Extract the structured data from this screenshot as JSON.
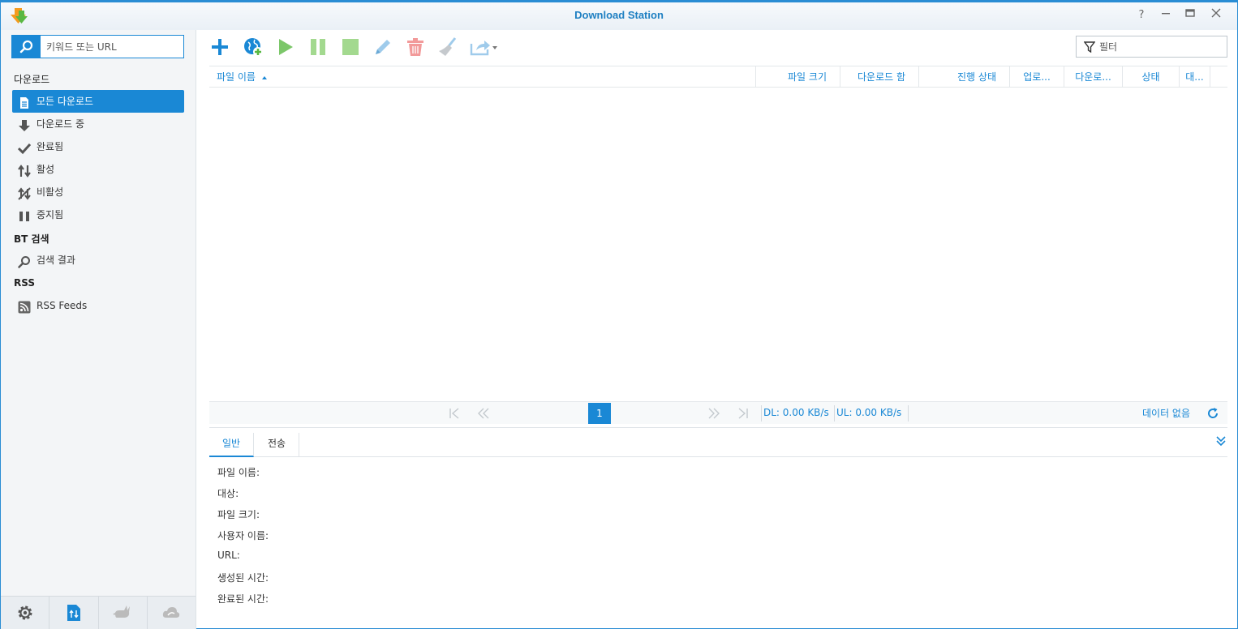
{
  "window": {
    "title": "Download Station"
  },
  "sidebar": {
    "search_placeholder": "키워드 또는 URL",
    "sections": {
      "download": "다운로드",
      "bt": "BT 검색",
      "rss": "RSS"
    },
    "items": [
      {
        "label": "모든 다운로드",
        "icon": "document-icon"
      },
      {
        "label": "다운로드 중",
        "icon": "arrow-down-icon"
      },
      {
        "label": "완료됨",
        "icon": "checkmark-icon"
      },
      {
        "label": "활성",
        "icon": "updown-arrows-icon"
      },
      {
        "label": "비활성",
        "icon": "inactive-icon"
      },
      {
        "label": "중지됨",
        "icon": "pause-icon"
      },
      {
        "label": "검색 결과",
        "icon": "search-icon"
      },
      {
        "label": "RSS Feeds",
        "icon": "rss-icon"
      }
    ]
  },
  "toolbar": {
    "filter_placeholder": "필터",
    "buttons": [
      "add-icon",
      "add-url-icon",
      "play-icon",
      "pause-icon",
      "stop-icon",
      "edit-icon",
      "delete-icon",
      "clear-icon",
      "share-icon"
    ]
  },
  "grid": {
    "columns": [
      "파일 이름",
      "파일 크기",
      "다운로드 함",
      "진행 상태",
      "업로...",
      "다운로...",
      "상태",
      "대..."
    ]
  },
  "pager": {
    "page": "1",
    "dl_speed": "DL: 0.00 KB/s",
    "ul_speed": "UL: 0.00 KB/s",
    "no_data": "데이터 없음"
  },
  "detail": {
    "tabs": [
      "일반",
      "전송"
    ],
    "fields": [
      "파일 이름:",
      "대상:",
      "파일 크기:",
      "사용자 이름:",
      "URL:",
      "생성된 시간:",
      "완료된 시간:"
    ]
  },
  "colors": {
    "accent": "#1a88d5",
    "title": "#1e7fc2",
    "play": "#7cc76a",
    "delete": "#f29a9a"
  }
}
